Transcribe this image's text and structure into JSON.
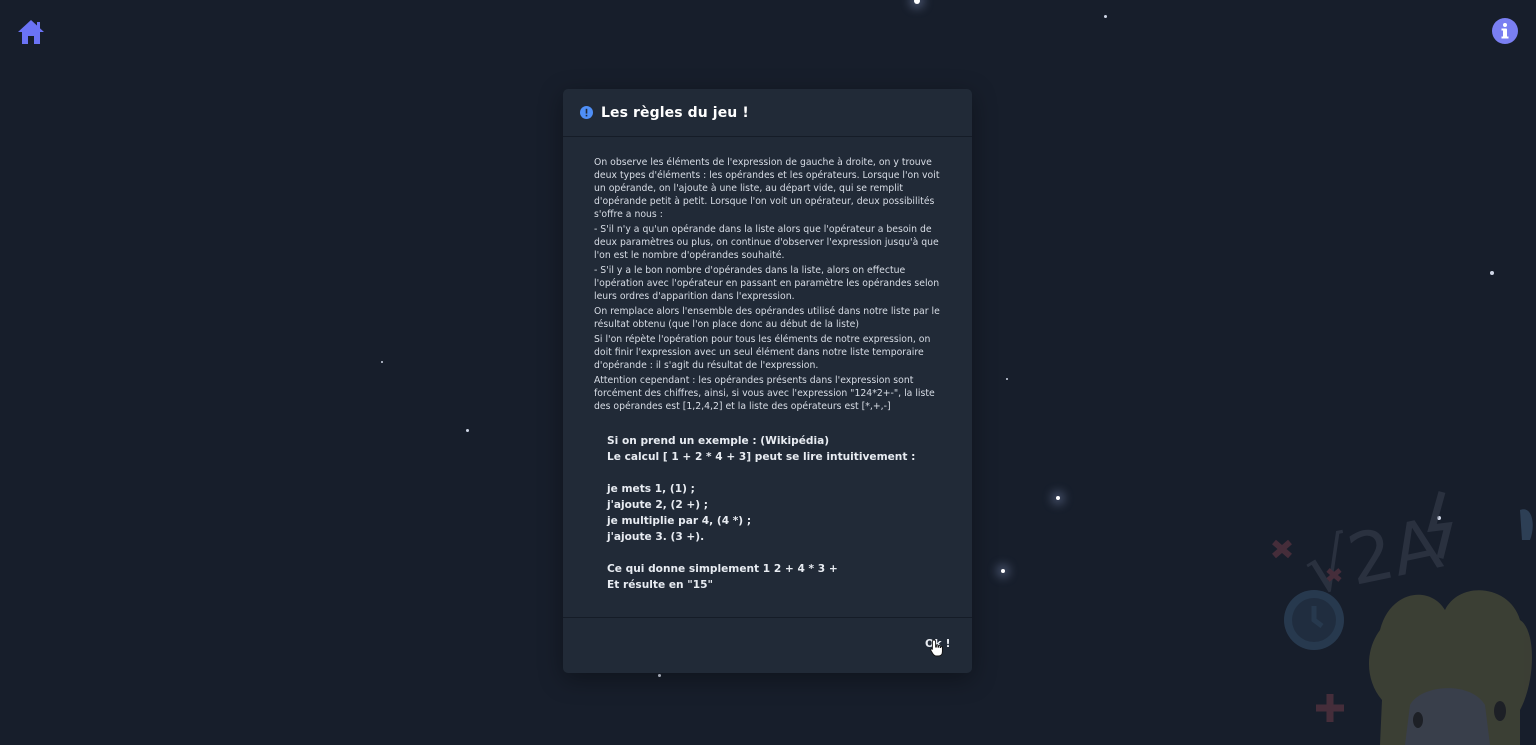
{
  "modal": {
    "title": "Les règles du jeu !",
    "rules": [
      "On observe les éléments de l'expression de gauche à droite, on y trouve deux types d'éléments : les opérandes et les opérateurs. Lorsque l'on voit un opérande, on l'ajoute à une liste, au départ vide, qui se remplit d'opérande petit à petit. Lorsque l'on voit un opérateur, deux possibilités s'offre a nous :",
      "- S'il n'y a qu'un opérande dans la liste alors que l'opérateur a besoin de deux paramètres ou plus, on continue d'observer l'expression jusqu'à que l'on est le nombre d'opérandes souhaité.",
      "- S'il y a le bon nombre d'opérandes dans la liste, alors on effectue l'opération avec l'opérateur en passant en paramètre les opérandes selon leurs ordres d'apparition dans l'expression.",
      "On remplace alors l'ensemble des opérandes utilisé dans notre liste par le résultat obtenu (que l'on place donc au début de la liste)",
      "Si l'on répète l'opération pour tous les éléments de notre expression, on doit finir l'expression avec un seul élément dans notre liste temporaire d'opérande : il s'agit du résultat de l'expression.",
      "Attention cependant : les opérandes présents dans l'expression sont forcément des chiffres, ainsi, si vous avec l'expression \"124*2+-\", la liste des opérandes est [1,2,4,2] et la liste des opérateurs est [*,+,-]"
    ],
    "example": {
      "intro": "Si on prend un exemple : (Wikipédia)",
      "calc": "Le calcul [ 1 + 2 * 4 + 3] peut se lire intuitivement :",
      "steps": [
        "je mets 1, (1) ;",
        "j'ajoute 2, (2 +) ;",
        "je multiplie par 4, (4 *) ;",
        "j'ajoute 3. (3 +)."
      ],
      "result_line1": "Ce qui donne simplement 1 2 + 4 * 3 +",
      "result_line2": "Et résulte en \"15\""
    },
    "ok_label": "Ok !"
  },
  "colors": {
    "background": "#171e2b",
    "modal": "#212a37",
    "accent": "#6b73f5",
    "info_icon": "#4f8ff7"
  },
  "icons": {
    "home": "home-icon",
    "info": "info-icon",
    "header": "info-circle-icon"
  }
}
